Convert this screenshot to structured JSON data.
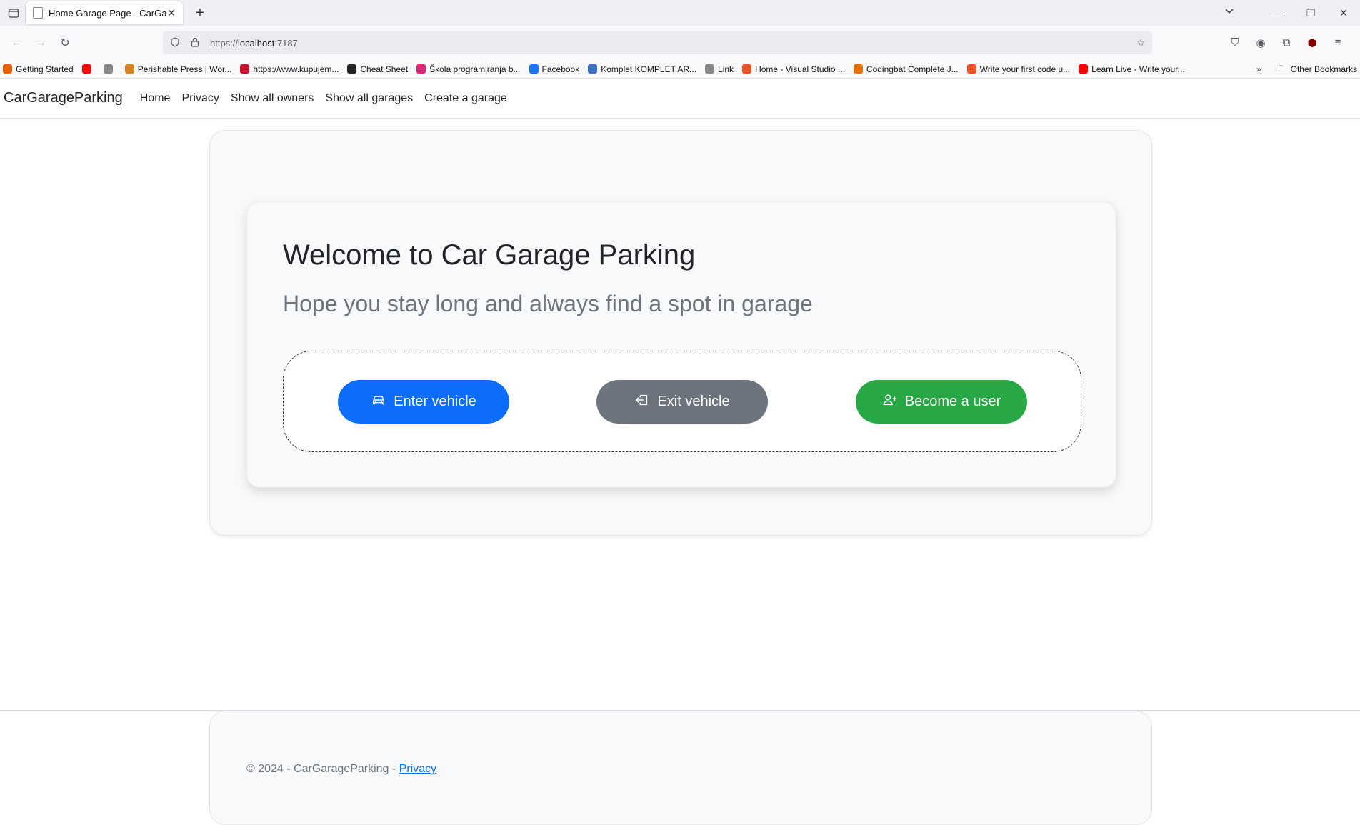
{
  "browser": {
    "tab_title": "Home Garage Page - CarGarage",
    "url_prefix": "https://",
    "url_host": "localhost",
    "url_port": ":7187",
    "bookmarks": [
      {
        "label": "Getting Started",
        "color": "#e66000"
      },
      {
        "label": "",
        "color": "#ff0000"
      },
      {
        "label": "",
        "color": "#888888"
      },
      {
        "label": "Perishable Press | Wor...",
        "color": "#d9831f"
      },
      {
        "label": "https://www.kupujem...",
        "color": "#c8102e"
      },
      {
        "label": "Cheat Sheet",
        "color": "#222222"
      },
      {
        "label": "Škola programiranja b...",
        "color": "#d62976"
      },
      {
        "label": "Facebook",
        "color": "#1877f2"
      },
      {
        "label": "Komplet KOMPLET AR...",
        "color": "#3b6fc4"
      },
      {
        "label": "Link",
        "color": "#888888"
      },
      {
        "label": "Home - Visual Studio ...",
        "color": "#f25022"
      },
      {
        "label": "Codingbat Complete J...",
        "color": "#e76f00"
      },
      {
        "label": "Write your first code u...",
        "color": "#f25022"
      },
      {
        "label": "Learn Live - Write your...",
        "color": "#ff0000"
      }
    ],
    "other_bookmarks": "Other Bookmarks"
  },
  "nav": {
    "brand": "CarGarageParking",
    "links": [
      "Home",
      "Privacy",
      "Show all owners",
      "Show all garages",
      "Create a garage"
    ]
  },
  "hero": {
    "title": "Welcome to Car Garage Parking",
    "subtitle": "Hope you stay long and always find a spot in garage",
    "buttons": {
      "enter": "Enter vehicle",
      "exit": "Exit vehicle",
      "become": "Become a user"
    }
  },
  "footer": {
    "text": "© 2024 - CarGarageParking - ",
    "privacy": "Privacy"
  },
  "colors": {
    "primary": "#0d6efd",
    "secondary": "#6c757d",
    "success": "#28a745"
  }
}
